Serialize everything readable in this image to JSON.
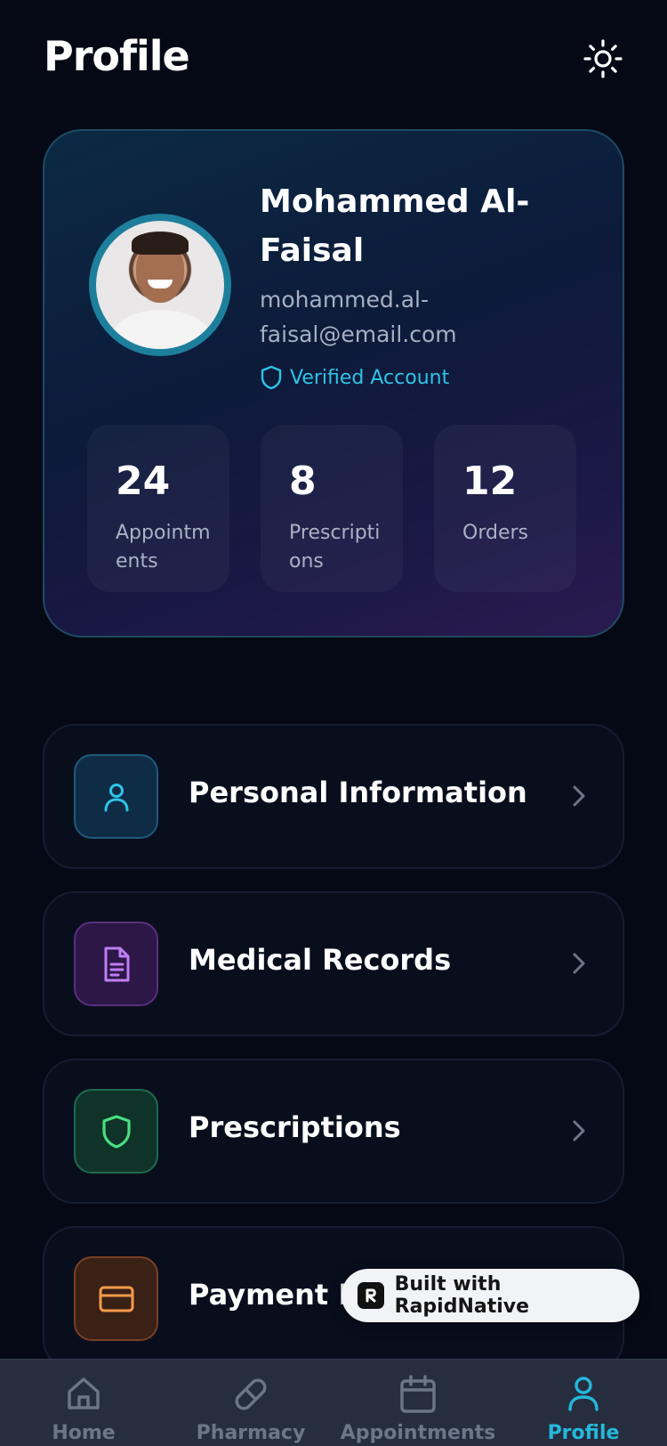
{
  "header": {
    "title": "Profile",
    "theme_icon": "sun-icon"
  },
  "profile": {
    "name": "Mohammed Al-Faisal",
    "email": "mohammed.al-faisal@email.com",
    "verified_label": "Verified Account",
    "stats": [
      {
        "value": "24",
        "label": "Appointments"
      },
      {
        "value": "8",
        "label": "Prescriptions"
      },
      {
        "value": "12",
        "label": "Orders"
      }
    ]
  },
  "menu": [
    {
      "label": "Personal Information",
      "icon": "user-icon",
      "color": "#2ec4e6"
    },
    {
      "label": "Medical Records",
      "icon": "document-icon",
      "color": "#c07ef2"
    },
    {
      "label": "Prescriptions",
      "icon": "shield-icon",
      "color": "#4ade80"
    },
    {
      "label": "Payment Methods",
      "icon": "credit-card-icon",
      "color": "#f59a4a"
    }
  ],
  "badge": {
    "label": "Built with RapidNative"
  },
  "tabs": [
    {
      "label": "Home",
      "icon": "home-icon"
    },
    {
      "label": "Pharmacy",
      "icon": "pill-icon"
    },
    {
      "label": "Appointments",
      "icon": "calendar-icon"
    },
    {
      "label": "Profile",
      "icon": "user-icon",
      "active": true
    }
  ],
  "colors": {
    "accent": "#24b8da",
    "background": "#050915"
  }
}
